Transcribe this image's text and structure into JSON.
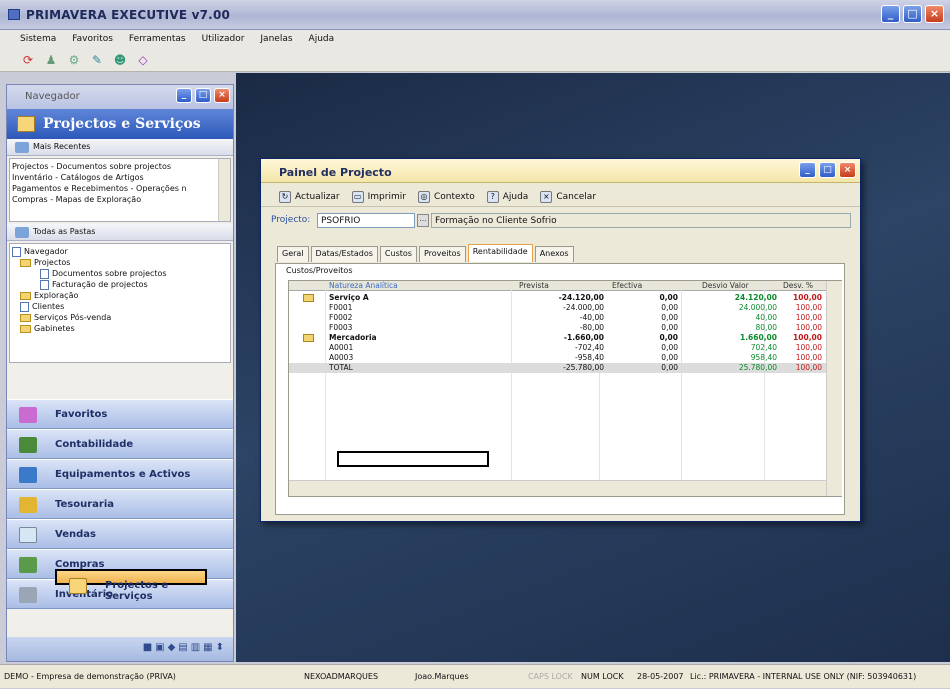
{
  "app": {
    "title": "PRIMAVERA EXECUTIVE v7.00"
  },
  "menu": [
    "Sistema",
    "Favoritos",
    "Ferramentas",
    "Utilizador",
    "Janelas",
    "Ajuda"
  ],
  "navigator": {
    "title": "Navegador",
    "header": "Projectos e Serviços",
    "recent_title": "Mais Recentes",
    "recent": [
      "Projectos - Documentos sobre projectos",
      "Inventário - Catálogos de Artigos",
      "Pagamentos e Recebimentos - Operações n",
      "Compras - Mapas de Exploração"
    ],
    "folders_title": "Todas as Pastas",
    "tree": [
      "Navegador",
      "Projectos",
      "Documentos sobre projectos",
      "Facturação de projectos",
      "Exploração",
      "Clientes",
      "Serviços Pós-venda",
      "Gabinetes"
    ],
    "modules": [
      "Favoritos",
      "Contabilidade",
      "Equipamentos e Activos",
      "Tesouraria",
      "Vendas",
      "Compras",
      "Inventário",
      "Projectos e Serviços"
    ]
  },
  "dialog": {
    "title": "Painel de Projecto",
    "toolbar": [
      "Actualizar",
      "Imprimir",
      "Contexto",
      "Ajuda",
      "Cancelar"
    ],
    "project_label": "Projecto:",
    "project_code": "PSOFRIO",
    "project_desc": "Formação no Cliente Sofrio",
    "tabs": [
      "Geral",
      "Datas/Estados",
      "Custos",
      "Proveitos",
      "Rentabilidade",
      "Anexos"
    ],
    "panel_label": "Custos/Proveitos",
    "columns": [
      "Natureza Analítica",
      "Prevista",
      "Efectiva",
      "Desvio Valor",
      "Desv. %"
    ],
    "rows": [
      {
        "name": "Serviço A",
        "prev": "-24.120,00",
        "efec": "0,00",
        "desv": "24.120,00",
        "pct": "100,00",
        "bold": true,
        "icon": true
      },
      {
        "name": "F0001",
        "prev": "-24.000,00",
        "efec": "0,00",
        "desv": "24.000,00",
        "pct": "100,00"
      },
      {
        "name": "F0002",
        "prev": "-40,00",
        "efec": "0,00",
        "desv": "40,00",
        "pct": "100,00"
      },
      {
        "name": "F0003",
        "prev": "-80,00",
        "efec": "0,00",
        "desv": "80,00",
        "pct": "100,00"
      },
      {
        "name": "Mercadoria",
        "prev": "-1.660,00",
        "efec": "0,00",
        "desv": "1.660,00",
        "pct": "100,00",
        "bold": true,
        "icon": true
      },
      {
        "name": "A0001",
        "prev": "-702,40",
        "efec": "0,00",
        "desv": "702,40",
        "pct": "100,00"
      },
      {
        "name": "A0003",
        "prev": "-958,40",
        "efec": "0,00",
        "desv": "958,40",
        "pct": "100,00"
      },
      {
        "name": "TOTAL",
        "prev": "-25.780,00",
        "efec": "0,00",
        "desv": "25.780,00",
        "pct": "100,00",
        "total": true
      }
    ]
  },
  "status": {
    "company": "DEMO - Empresa de demonstração (PRIVA)",
    "user": "NEXOADMARQUES",
    "name": "Joao.Marques",
    "caps": "CAPS LOCK",
    "num": "NUM LOCK",
    "date": "28-05-2007",
    "lic": "Lic.: PRIMAVERA - INTERNAL USE ONLY (NIF: 503940631)"
  }
}
